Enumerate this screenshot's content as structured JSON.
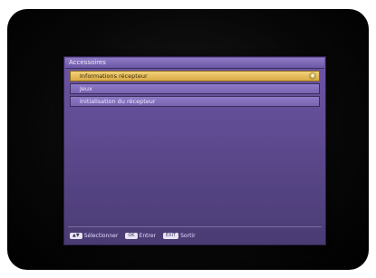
{
  "screen": {
    "title": "Accessoires",
    "menu_items": [
      {
        "label": "Informations récepteur",
        "selected": true,
        "indicator": "◉"
      },
      {
        "label": "Jeux",
        "selected": false
      },
      {
        "label": "Initialisation du récepteur",
        "selected": false
      }
    ],
    "footer": {
      "select": {
        "key": "▲▼",
        "label": "Sélectionner"
      },
      "enter": {
        "key": "OK",
        "label": "Entrer"
      },
      "exit": {
        "key": "EXIT",
        "label": "Sortir"
      }
    }
  }
}
